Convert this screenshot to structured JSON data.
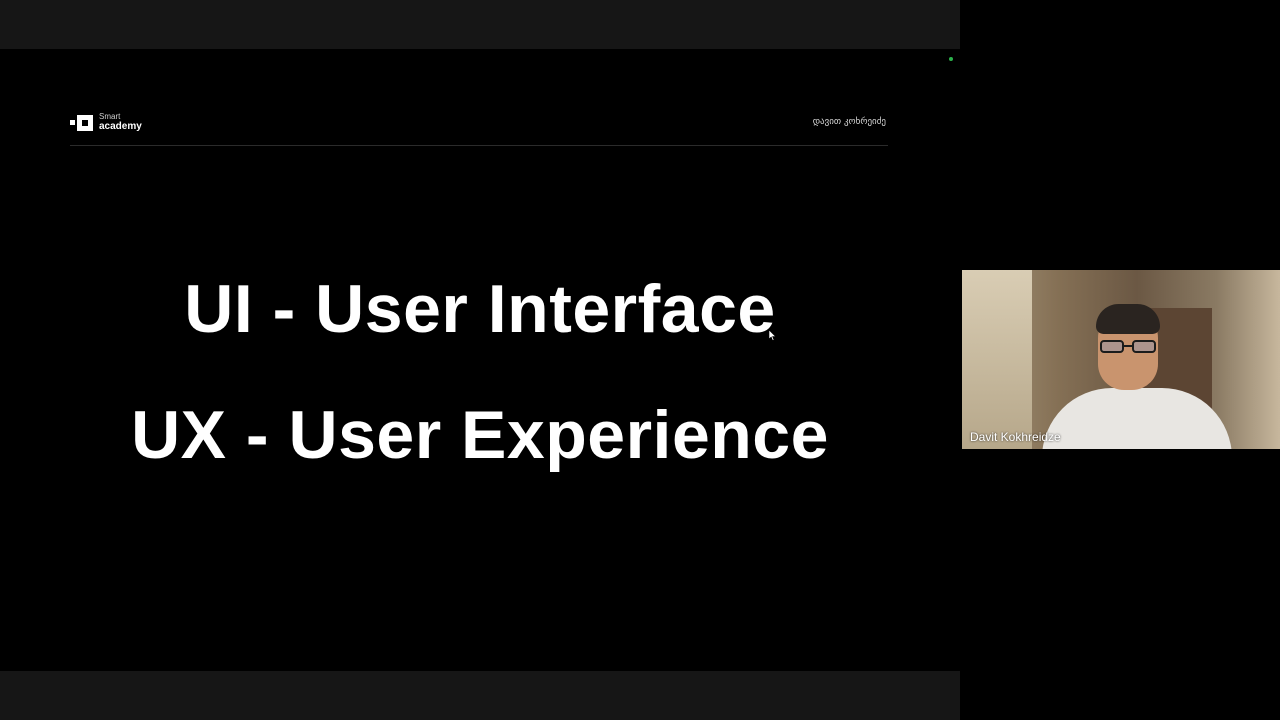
{
  "slide": {
    "logo": {
      "line1": "Smart",
      "line2": "academy"
    },
    "presenter_label": "დავით კოხრეიძე",
    "titles": [
      "UI - User Interface",
      "UX - User Experience"
    ]
  },
  "participant": {
    "name": "Davit Kokhreidze"
  },
  "colors": {
    "chrome_bar": "#161616",
    "background": "#000000",
    "title_text": "#ffffff",
    "active_indicator": "#2bb24c"
  }
}
